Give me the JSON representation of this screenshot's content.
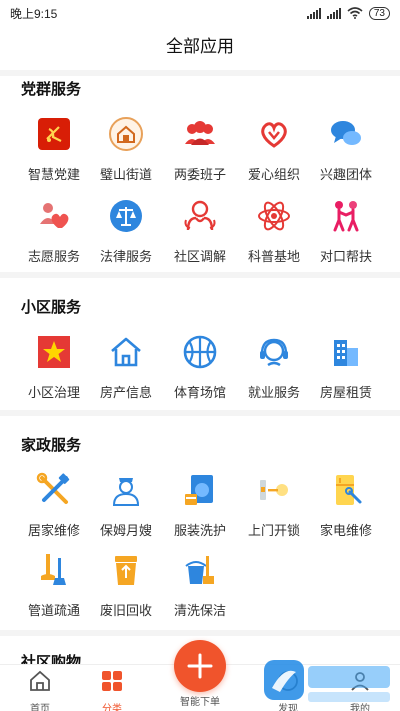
{
  "status_bar": {
    "time": "晚上9:15",
    "battery": "73"
  },
  "header": {
    "title": "全部应用"
  },
  "sections": [
    {
      "title": "党群服务",
      "items": [
        {
          "label": "智慧党建",
          "icon": "party-flag-icon"
        },
        {
          "label": "璧山街道",
          "icon": "street-house-icon"
        },
        {
          "label": "两委班子",
          "icon": "group-people-icon"
        },
        {
          "label": "爱心组织",
          "icon": "heart-hands-icon"
        },
        {
          "label": "兴趣团体",
          "icon": "chat-bubbles-icon"
        },
        {
          "label": "志愿服务",
          "icon": "volunteer-heart-icon"
        },
        {
          "label": "法律服务",
          "icon": "scales-icon"
        },
        {
          "label": "社区调解",
          "icon": "mediation-people-icon"
        },
        {
          "label": "科普基地",
          "icon": "atom-icon"
        },
        {
          "label": "对口帮扶",
          "icon": "helping-people-icon"
        }
      ]
    },
    {
      "title": "小区服务",
      "items": [
        {
          "label": "小区治理",
          "icon": "star-flag-icon"
        },
        {
          "label": "房产信息",
          "icon": "house-icon"
        },
        {
          "label": "体育场馆",
          "icon": "basketball-icon"
        },
        {
          "label": "就业服务",
          "icon": "headset-icon"
        },
        {
          "label": "房屋租赁",
          "icon": "building-icon"
        }
      ]
    },
    {
      "title": "家政服务",
      "items": [
        {
          "label": "居家维修",
          "icon": "tools-icon"
        },
        {
          "label": "保姆月嫂",
          "icon": "nanny-icon"
        },
        {
          "label": "服装洗护",
          "icon": "washing-machine-icon"
        },
        {
          "label": "上门开锁",
          "icon": "key-icon"
        },
        {
          "label": "家电维修",
          "icon": "fridge-repair-icon"
        },
        {
          "label": "管道疏通",
          "icon": "plunger-icon"
        },
        {
          "label": "废旧回收",
          "icon": "recycle-bin-icon"
        },
        {
          "label": "清洗保洁",
          "icon": "cleaning-bucket-icon"
        }
      ]
    },
    {
      "title": "社区购物"
    }
  ],
  "tabbar": {
    "home": "首页",
    "category": "分类",
    "order": "智能下单",
    "faxian": "发现",
    "mine": "我的"
  },
  "colors": {
    "accent": "#f0542c",
    "blue": "#3a8ee6",
    "red": "#e53935",
    "orange": "#f5a623"
  }
}
